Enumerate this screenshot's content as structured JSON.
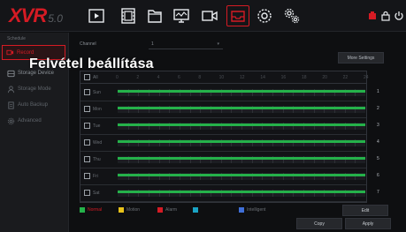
{
  "brand": {
    "name": "XVR",
    "version": "5.0"
  },
  "nav_icons": [
    "playback-icon",
    "film-icon",
    "folder-icon",
    "network-icon",
    "camera-icon",
    "storage-icon",
    "settings-icon",
    "system-settings-icon"
  ],
  "top_right_icons": [
    "alarm-icon",
    "lock-icon",
    "power-icon"
  ],
  "sidebar": {
    "header": "Schedule",
    "items": [
      {
        "label": "Record",
        "icon": "record-icon",
        "selected": true
      },
      {
        "label": "Storage Device",
        "icon": "hdd-icon",
        "selected": false
      },
      {
        "label": "Storage Mode",
        "icon": "storage-mode-icon",
        "selected": false
      },
      {
        "label": "Auto Backup",
        "icon": "backup-icon",
        "selected": false
      },
      {
        "label": "Advanced",
        "icon": "advanced-icon",
        "selected": false
      }
    ]
  },
  "overlay_title": "Felvétel beállítása",
  "channel": {
    "label": "Channel",
    "value": "1"
  },
  "more_settings_label": "More Settings",
  "schedule": {
    "all_label": "All",
    "hours": [
      "0",
      "2",
      "4",
      "6",
      "8",
      "10",
      "12",
      "14",
      "16",
      "18",
      "20",
      "22",
      "24"
    ],
    "days": [
      {
        "name": "Sun",
        "num": "1",
        "type": "Normal",
        "start": 0,
        "end": 24
      },
      {
        "name": "Mon",
        "num": "2",
        "type": "Normal",
        "start": 0,
        "end": 24
      },
      {
        "name": "Tue",
        "num": "3",
        "type": "Normal",
        "start": 0,
        "end": 24
      },
      {
        "name": "Wed",
        "num": "4",
        "type": "Normal",
        "start": 0,
        "end": 24
      },
      {
        "name": "Thu",
        "num": "5",
        "type": "Normal",
        "start": 0,
        "end": 24
      },
      {
        "name": "Fri",
        "num": "6",
        "type": "Normal",
        "start": 0,
        "end": 24
      },
      {
        "name": "Sat",
        "num": "7",
        "type": "Normal",
        "start": 0,
        "end": 24
      }
    ]
  },
  "legend": [
    {
      "label": "Normal",
      "color": "#25b24a",
      "text_color": "#d51b24"
    },
    {
      "label": "Motion",
      "color": "#e8c21a",
      "text_color": "#6b7076"
    },
    {
      "label": "Alarm",
      "color": "#d51b24",
      "text_color": "#6b7076"
    },
    {
      "label": "",
      "color": "#1aa3c4",
      "text_color": "#6b7076"
    },
    {
      "label": "Intelligent",
      "color": "#3f6fd8",
      "text_color": "#6b7076"
    }
  ],
  "buttons": {
    "edit": "Edit",
    "copy": "Copy",
    "apply": "Apply"
  },
  "colors": {
    "accent": "#d51b24",
    "record_bar": "#25b24a"
  }
}
